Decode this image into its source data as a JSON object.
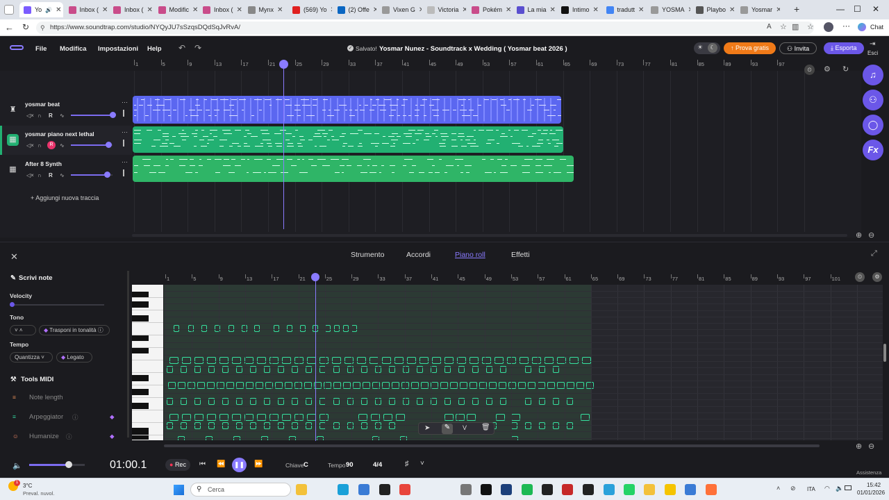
{
  "browser": {
    "tabs": [
      {
        "label": "Yo",
        "color": "#7b5cff"
      },
      {
        "label": "Inbox (",
        "color": "#c94c8a"
      },
      {
        "label": "Inbox (",
        "color": "#c94c8a"
      },
      {
        "label": "Modific",
        "color": "#c94c8a"
      },
      {
        "label": "Inbox (",
        "color": "#c94c8a"
      },
      {
        "label": "Mynx",
        "color": "#888888"
      },
      {
        "label": "(569) Yo",
        "color": "#e02020"
      },
      {
        "label": "(2) Offe",
        "color": "#0a66c2"
      },
      {
        "label": "Vixen G",
        "color": "#999999"
      },
      {
        "label": "Victoria",
        "color": "#bbbbbb"
      },
      {
        "label": "Pokém",
        "color": "#c94c8a"
      },
      {
        "label": "La mia",
        "color": "#5a4fcf"
      },
      {
        "label": "Intimo",
        "color": "#111111"
      },
      {
        "label": "tradutt",
        "color": "#4285f4"
      },
      {
        "label": "YOSMA",
        "color": "#999999"
      },
      {
        "label": "Playbo",
        "color": "#555555"
      },
      {
        "label": "Yosmar",
        "color": "#999999"
      }
    ],
    "new_tab": "+",
    "url": "https://www.soundtrap.com/studio/NYQyJU7sSzqsDQdSqJvRvA/",
    "chat_label": "Chat"
  },
  "header": {
    "menus": [
      "File",
      "Modifica",
      "Impostazioni",
      "Help"
    ],
    "saved": "Salvato!",
    "project_title": "Yosmar Nunez - Soundtrack x Wedding ( Yosmar beat 2026 )",
    "try_free": "Prova gratis",
    "invite": "Invita",
    "export": "Esporta",
    "exit": "Esci"
  },
  "ruler_top": [
    "1",
    "5",
    "9",
    "13",
    "17",
    "21",
    "25",
    "29",
    "33",
    "37",
    "41",
    "45",
    "49",
    "53",
    "57",
    "61",
    "65",
    "69",
    "73",
    "77",
    "81",
    "85",
    "89",
    "93",
    "97"
  ],
  "tracks": [
    {
      "name": "yosmar beat",
      "r": "R",
      "color": "#5b67f0"
    },
    {
      "name": "yosmar piano next lethal",
      "r": "R",
      "color": "#22b072"
    },
    {
      "name": "After 8 Synth",
      "r": "R",
      "color": "#2fb567"
    }
  ],
  "add_track": "Aggiungi nuova traccia",
  "panel": {
    "tabs": [
      "Strumento",
      "Accordi",
      "Piano roll",
      "Effetti"
    ],
    "active_tab": "Piano roll",
    "write_notes": "Scrivi note",
    "velocity": "Velocity",
    "tone": "Tono",
    "transpose": "Trasponi in tonalità",
    "tempo": "Tempo",
    "quantize": "Quantizza",
    "legato": "Legato",
    "midi_tools": "Tools MIDI",
    "note_length": "Note length",
    "arpeggiator": "Arpeggiator",
    "humanize": "Humanize"
  },
  "ruler_bottom": [
    "1",
    "5",
    "9",
    "13",
    "17",
    "21",
    "25",
    "29",
    "33",
    "37",
    "41",
    "45",
    "49",
    "53",
    "57",
    "61",
    "65",
    "69",
    "73",
    "77",
    "81",
    "85",
    "89",
    "93",
    "97",
    "101"
  ],
  "transport": {
    "time": "01:00.1",
    "rec": "Rec",
    "key_label": "Chiave",
    "key": "C",
    "tempo_label": "Tempo",
    "tempo": "90",
    "meter": "4/4",
    "assist": "Assistenza"
  },
  "taskbar": {
    "weather_temp": "3°C",
    "weather_desc": "Preval. nuvol.",
    "search": "Cerca",
    "lang": "ITA",
    "clock": "15:42",
    "date": "01/01/2026"
  }
}
